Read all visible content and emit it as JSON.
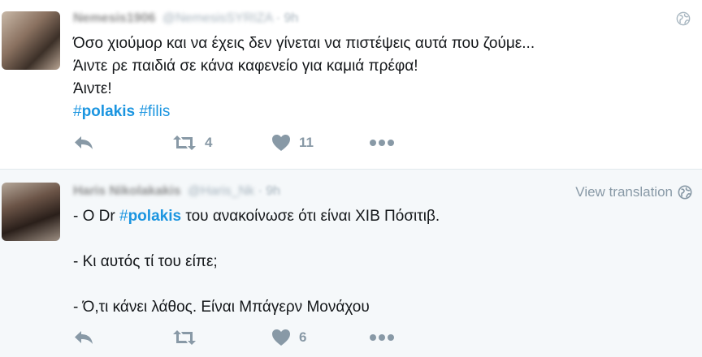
{
  "tweets": [
    {
      "fullname": "Nemesis1906",
      "username": "@NemesisSYRIZA",
      "dot": "·",
      "time": "9h",
      "lines": [
        "Όσο χιούμορ και να έχεις δεν γίνεται να πιστέψεις αυτά που ζούμε...",
        "Άιντε ρε παιδιά σε κάνα καφενείο για καμιά πρέφα!",
        "Άιντε!"
      ],
      "hashtags": [
        {
          "hash": "#",
          "tag": "polakis",
          "bold": true
        },
        {
          "hash": "#",
          "tag": "filis",
          "bold": false
        }
      ],
      "actions": {
        "retweets": "4",
        "likes": "11"
      }
    },
    {
      "fullname": "Haris Nikolakakis",
      "username": "@Haris_Nk",
      "dot": "·",
      "time": "9h",
      "view_translation": "View translation",
      "line1_before": "- Ο Dr ",
      "line1_hash": "#",
      "line1_tag": "polakis",
      "line1_after": " του ανακοίνωσε ότι είναι ΧΙΒ Πόσιτιβ.",
      "line2": "- Κι αυτός τί του είπε;",
      "line3": "- Ό,τι κάνει λάθος. Είναι Μπάγερν Μονάχου",
      "actions": {
        "retweets": "",
        "likes": "6"
      }
    }
  ],
  "icons": {
    "reply": "reply-icon",
    "retweet": "retweet-icon",
    "like": "heart-icon",
    "more": "more-dots-icon",
    "globe": "globe-icon"
  },
  "colors": {
    "link": "#1b95e0",
    "muted": "#8899a6",
    "text": "#14171a",
    "alt_background": "#f5f8fa"
  }
}
